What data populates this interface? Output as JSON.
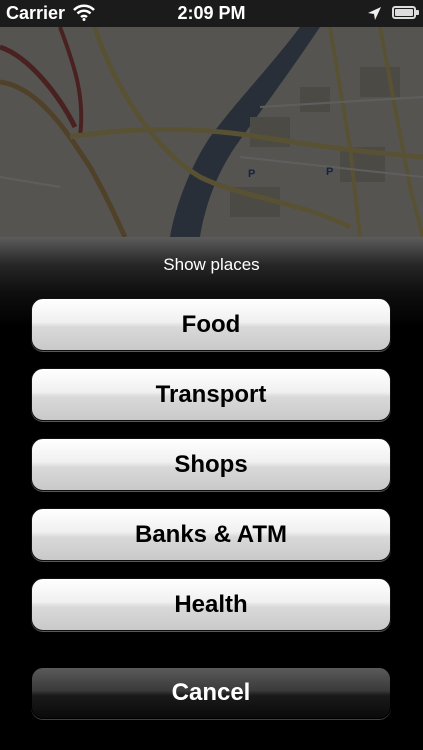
{
  "status_bar": {
    "carrier": "Carrier",
    "time": "2:09 PM"
  },
  "map": {
    "labels": [
      "P",
      "P"
    ]
  },
  "action_sheet": {
    "title": "Show places",
    "buttons": [
      "Food",
      "Transport",
      "Shops",
      "Banks & ATM",
      "Health"
    ],
    "cancel_label": "Cancel"
  },
  "icons": {
    "wifi": "wifi-icon",
    "location": "location-arrow-icon",
    "battery": "battery-icon"
  }
}
